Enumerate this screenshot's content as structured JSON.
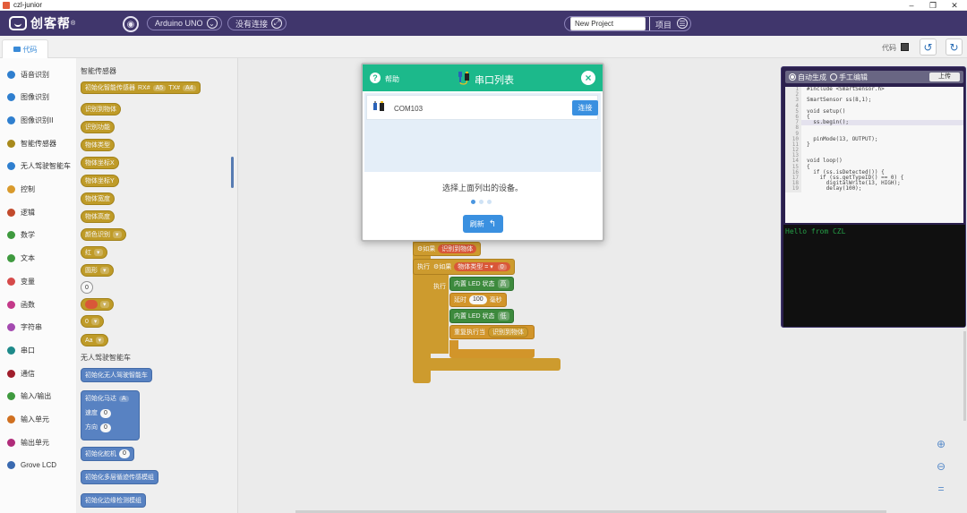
{
  "window": {
    "title": "czl-junior",
    "minimize": "–",
    "restore": "❐",
    "close": "✕"
  },
  "header": {
    "logo": "创客帮",
    "logo_mark": "®",
    "board": "Arduino UNO",
    "connection": "没有连接",
    "project_name": "New Project",
    "project_label": "项目"
  },
  "tabs": {
    "code_tab": "代码",
    "code_label": "代码"
  },
  "categories": [
    {
      "label": "语音识别",
      "color": "#2f7fcf"
    },
    {
      "label": "图像识别",
      "color": "#2f7fcf"
    },
    {
      "label": "图像识别II",
      "color": "#2f7fcf"
    },
    {
      "label": "智能传感器",
      "color": "#a88a1c"
    },
    {
      "label": "无人驾驶智能车",
      "color": "#2f7fcf"
    },
    {
      "label": "控制",
      "color": "#d99a2c"
    },
    {
      "label": "逻辑",
      "color": "#c24a2c"
    },
    {
      "label": "数学",
      "color": "#3f9a3f"
    },
    {
      "label": "文本",
      "color": "#3f9a3f"
    },
    {
      "label": "变量",
      "color": "#d64a4a"
    },
    {
      "label": "函数",
      "color": "#c43a8a"
    },
    {
      "label": "字符串",
      "color": "#a44ab0"
    },
    {
      "label": "串口",
      "color": "#1e8a8a"
    },
    {
      "label": "通信",
      "color": "#a01e2c"
    },
    {
      "label": "输入/输出",
      "color": "#3f9a3f"
    },
    {
      "label": "输入单元",
      "color": "#d07020"
    },
    {
      "label": "输出单元",
      "color": "#b02c7a"
    },
    {
      "label": "Grove LCD",
      "color": "#3a6ab0"
    }
  ],
  "flyout": {
    "section1": "智能传感器",
    "init_block": "初始化智能传感器",
    "init_port1": "RX#",
    "init_port1_val": "A5",
    "init_port2": "TX#",
    "init_port2_val": "A4",
    "detected": "识别到物体",
    "items": [
      "识别功能",
      "物体类型",
      "物体坐标X",
      "物体坐标Y",
      "物体宽度",
      "物体高度"
    ],
    "color_detect": "颜色识别",
    "red": "红",
    "shape": "圆形",
    "zero": "0",
    "section2": "无人驾驶智能车",
    "init_car": "初始化无人驾驶智能车",
    "init_motor": "初始化马达",
    "motor_port": "A",
    "speed": "速度",
    "direction": "方向",
    "init_servo": "初始化舵机",
    "init_multi_line": "初始化多层循迹传感模组",
    "init_edge": "初始化边缘检测模组"
  },
  "workspace": {
    "if_label": "如果",
    "if_detected": "识别到物体",
    "then_label": "执行",
    "object_type": "物体类型",
    "op": "=",
    "val0": "0",
    "led_on": "内置 LED 状态",
    "led_on_val": "高",
    "delay": "延时",
    "delay_val": "100",
    "delay_unit": "毫秒",
    "led_off": "内置 LED 状态",
    "led_off_val": "低",
    "repeat": "重复执行当",
    "repeat_cond": "识别到物体"
  },
  "code_panel": {
    "auto": "自动生成",
    "manual": "手工编辑",
    "upload": "上传",
    "lines": [
      {
        "n": "1",
        "t": "#include <SmartSensor.h>"
      },
      {
        "n": "2",
        "t": ""
      },
      {
        "n": "3",
        "t": "SmartSensor ss(8,1);"
      },
      {
        "n": "4",
        "t": ""
      },
      {
        "n": "5",
        "t": "void setup()"
      },
      {
        "n": "6",
        "t": "{"
      },
      {
        "n": "7",
        "t": "  ss.begin();"
      },
      {
        "n": "8",
        "t": ""
      },
      {
        "n": "9",
        "t": ""
      },
      {
        "n": "10",
        "t": "  pinMode(13, OUTPUT);"
      },
      {
        "n": "11",
        "t": "}"
      },
      {
        "n": "12",
        "t": ""
      },
      {
        "n": "13",
        "t": ""
      },
      {
        "n": "14",
        "t": "void loop()"
      },
      {
        "n": "15",
        "t": "{"
      },
      {
        "n": "16",
        "t": "  if (ss.isDetected()) {"
      },
      {
        "n": "17",
        "t": "    if (ss.getTypeID() == 0) {"
      },
      {
        "n": "18",
        "t": "      digitalWrite(13, HIGH);"
      },
      {
        "n": "19",
        "t": "      delay(100);"
      }
    ],
    "console": "Hello from CZL"
  },
  "dialog": {
    "help": "帮助",
    "title": "串口列表",
    "port": "COM103",
    "connect": "连接",
    "message": "选择上面列出的设备。",
    "refresh": "刷新",
    "refresh_icon": "↰"
  },
  "colors": {
    "header_bg": "#40366c",
    "dialog_header": "#1cb98b",
    "primary_button": "#3a90e0"
  }
}
